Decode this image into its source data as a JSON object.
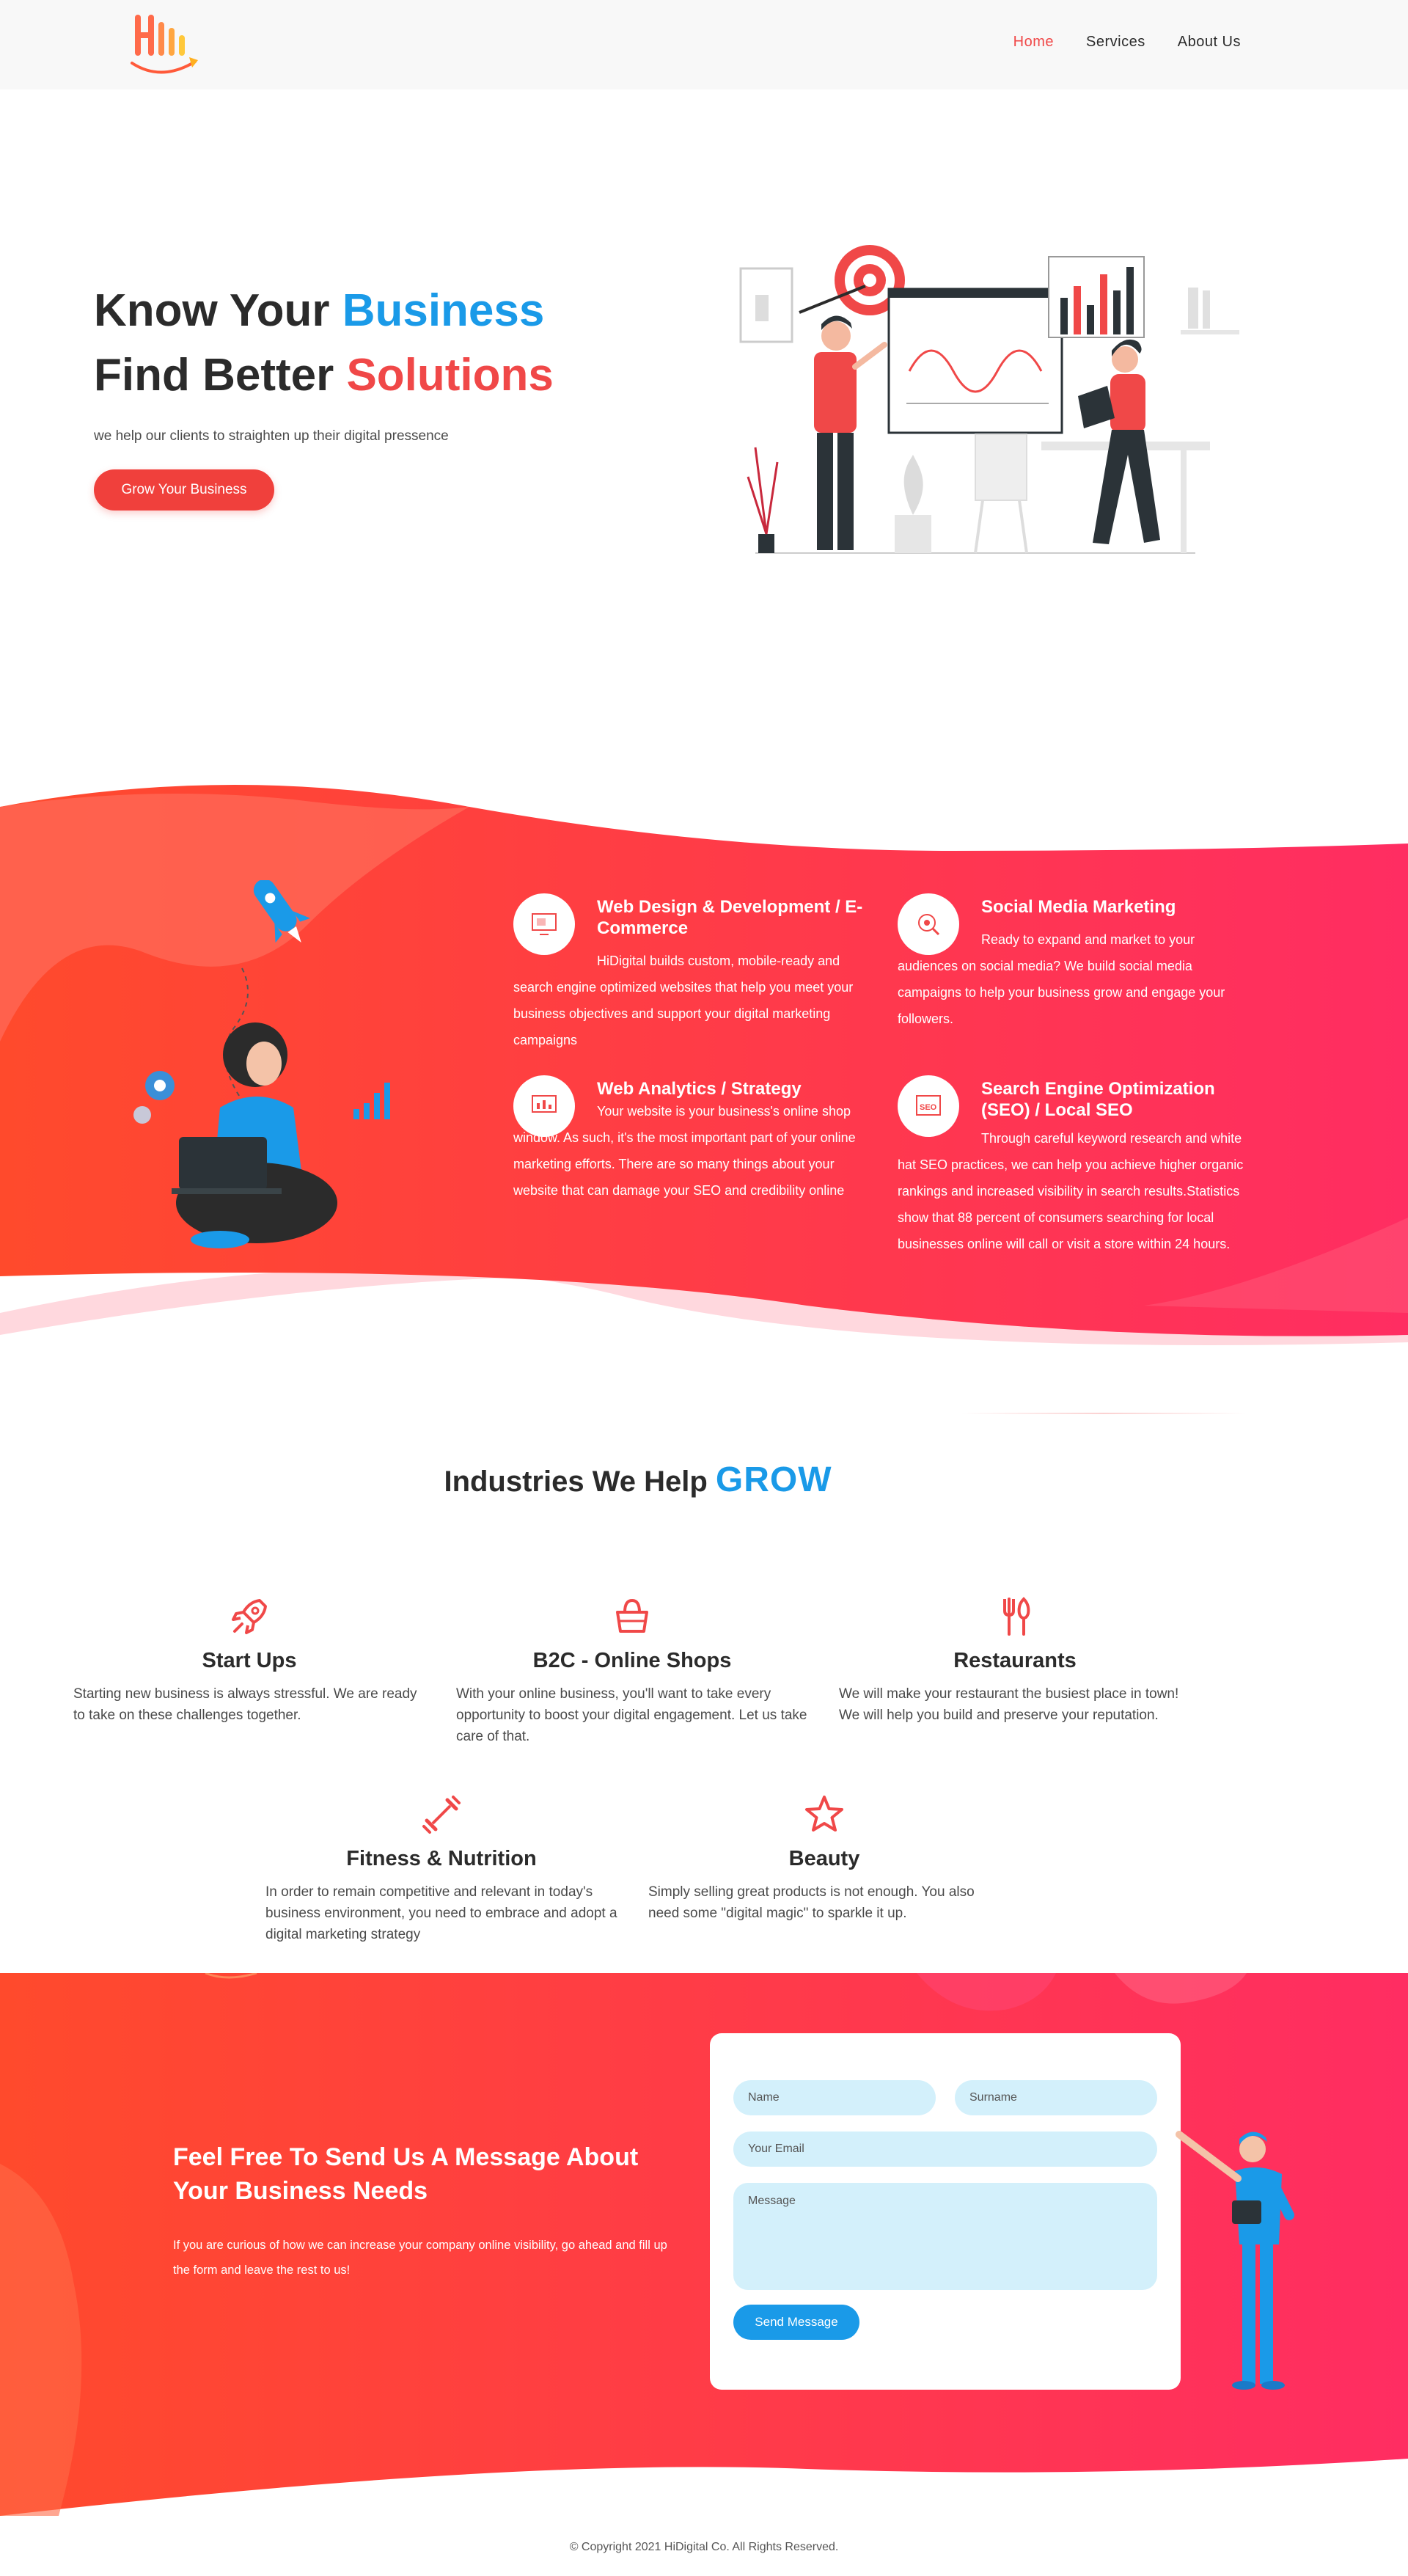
{
  "header": {
    "logo_alt": "Hi",
    "nav": [
      {
        "label": "Home",
        "active": true
      },
      {
        "label": "Services",
        "active": false
      },
      {
        "label": "About Us",
        "active": false
      }
    ]
  },
  "hero": {
    "line1_prefix": "Know Your ",
    "line1_highlight": "Business",
    "line2_prefix": "Find Better ",
    "line2_highlight": "Solutions",
    "subtitle": "we help our clients to straighten up their digital pressence",
    "cta": "Grow Your Business"
  },
  "services": [
    {
      "icon": "web-design-icon",
      "title": "Web Design & Development / E-Commerce",
      "text": "HiDigital builds custom, mobile-ready and search engine optimized websites that help you meet your business objectives and support your digital marketing campaigns"
    },
    {
      "icon": "social-media-icon",
      "title": "Social Media Marketing",
      "text": "Ready to expand and market to your audiences on social media? We build social media campaigns to help your business grow and engage your followers."
    },
    {
      "icon": "analytics-icon",
      "title": "Web Analytics / Strategy",
      "text": "Your website is your business's online shop window. As such, it's the most important part of your online marketing efforts. There are so many things about your website that can damage your SEO and credibility online"
    },
    {
      "icon": "seo-icon",
      "title": "Search Engine Optimization (SEO) / Local SEO",
      "text": "Through careful keyword research and white hat SEO practices, we can help you achieve higher organic rankings and increased visibility in search results.Statistics show that 88 percent of consumers searching for local businesses online will call or visit a store within 24 hours."
    }
  ],
  "industries": {
    "title_prefix": "Industries We Help ",
    "title_highlight": "GROW",
    "items": [
      {
        "icon": "rocket-icon",
        "title": "Start Ups",
        "text": "Starting new business is always stressful. We are ready to take on these challenges together."
      },
      {
        "icon": "basket-icon",
        "title": "B2C - Online Shops",
        "text": "With your online business, you'll want to take every opportunity to boost your digital engagement. Let us take care of that."
      },
      {
        "icon": "utensils-icon",
        "title": "Restaurants",
        "text": "We will make your restaurant the busiest place in town! We will help you build and preserve your reputation."
      },
      {
        "icon": "dumbbell-icon",
        "title": "Fitness & Nutrition",
        "text": "In order to remain competitive and relevant in today's business environment, you need to embrace and adopt a digital marketing strategy"
      },
      {
        "icon": "star-icon",
        "title": "Beauty",
        "text": "Simply selling great products is not enough. You also need some \"digital magic\" to sparkle it up."
      }
    ]
  },
  "contact": {
    "title": "Feel Free To Send Us A Message About Your Business Needs",
    "subtitle": "If you are curious of how we can increase your company online visibility, go ahead and fill up the form and leave the rest to us!",
    "form": {
      "name_placeholder": "Name",
      "surname_placeholder": "Surname",
      "email_placeholder": "Your Email",
      "message_placeholder": "Message",
      "submit": "Send Message"
    }
  },
  "footer": {
    "copyright": "© Copyright 2021 HiDigital Co. All Rights Reserved."
  },
  "colors": {
    "accent_red": "#f04848",
    "accent_blue": "#1a9ae8",
    "gradient_start": "#ff4a2c",
    "gradient_end": "#ff2d62",
    "input_bg": "#d3f0fb"
  }
}
